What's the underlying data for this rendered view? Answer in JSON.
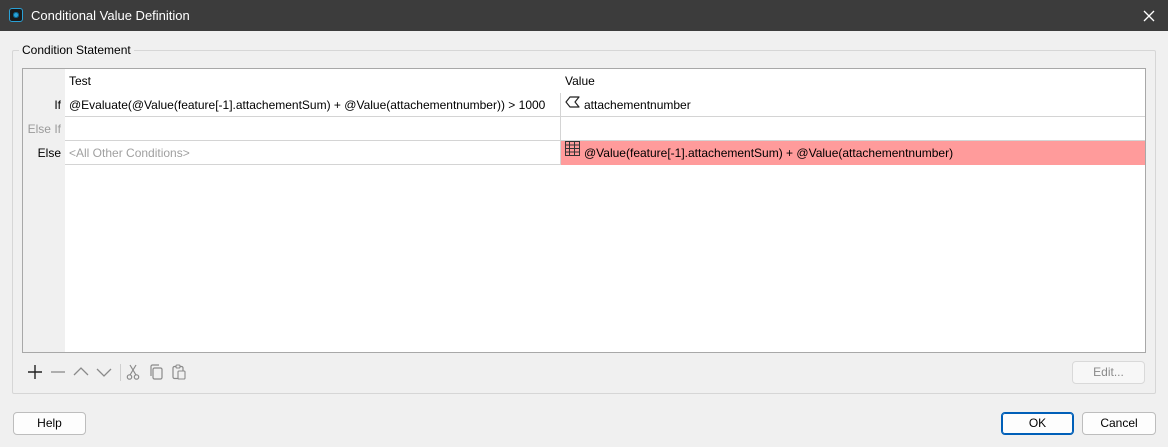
{
  "window": {
    "title": "Conditional Value Definition"
  },
  "group": {
    "label": "Condition Statement"
  },
  "grid": {
    "columns": {
      "test": "Test",
      "value": "Value"
    },
    "rows": [
      {
        "label": "If",
        "test": "@Evaluate(@Value(feature[-1].attachementSum) + @Value(attachementnumber)) > 1000",
        "value": "attachementnumber",
        "value_icon": "attribute-tag-icon"
      },
      {
        "label": "Else If",
        "test": "",
        "value": ""
      },
      {
        "label": "Else",
        "test": "<All Other Conditions>",
        "value": "@Value(feature[-1].attachementSum) + @Value(attachementnumber)",
        "value_icon": "table-grid-icon",
        "value_highlight": "#ff9b9b"
      }
    ]
  },
  "toolbar": {
    "icons": [
      "plus-icon",
      "minus-icon",
      "move-up-icon",
      "move-down-icon",
      "cut-icon",
      "copy-icon",
      "paste-icon"
    ],
    "edit_label": "Edit..."
  },
  "footer": {
    "help_label": "Help",
    "ok_label": "OK",
    "cancel_label": "Cancel"
  },
  "colors": {
    "titlebar": "#3c3c3c",
    "error_cell": "#ff9b9b",
    "accent": "#005fb8"
  }
}
